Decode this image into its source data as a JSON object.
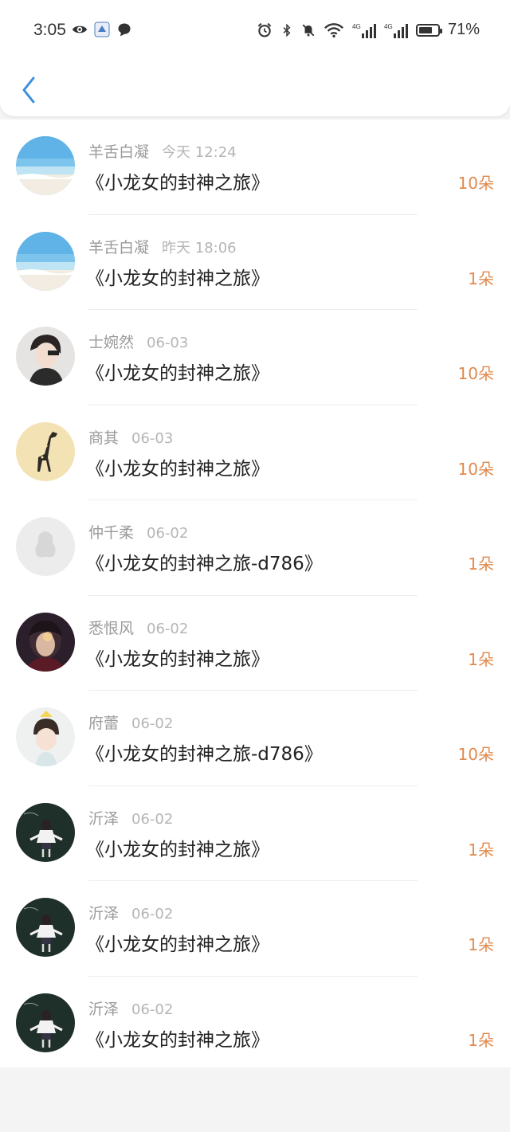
{
  "status_bar": {
    "time": "3:05",
    "battery_pct": "71%",
    "battery_level": 0.71,
    "icons": [
      "eye-icon",
      "app-badge-icon",
      "chat-bubble-icon",
      "alarm-icon",
      "bluetooth-icon",
      "mute-icon",
      "wifi-icon",
      "signal-4g-icon",
      "signal-4g-icon",
      "battery-icon"
    ]
  },
  "header": {
    "back_icon": "chevron-left-icon",
    "accent": "#3b8fe0"
  },
  "colors": {
    "amount": "#e08a4d",
    "name": "#9a9a9a",
    "title": "#222222"
  },
  "items": [
    {
      "name": "羊舌白凝",
      "time": "今天 12:24",
      "title": "《小龙女的封神之旅》",
      "amount": "10朵",
      "avatar": "beach"
    },
    {
      "name": "羊舌白凝",
      "time": "昨天 18:06",
      "title": "《小龙女的封神之旅》",
      "amount": "1朵",
      "avatar": "beach"
    },
    {
      "name": "士婉然",
      "time": "06-03",
      "title": "《小龙女的封神之旅》",
      "amount": "10朵",
      "avatar": "boy"
    },
    {
      "name": "商其",
      "time": "06-03",
      "title": "《小龙女的封神之旅》",
      "amount": "10朵",
      "avatar": "giraffe"
    },
    {
      "name": "仲千柔",
      "time": "06-02",
      "title": "《小龙女的封神之旅-d786》",
      "amount": "1朵",
      "avatar": "default"
    },
    {
      "name": "悉恨风",
      "time": "06-02",
      "title": "《小龙女的封神之旅》",
      "amount": "1朵",
      "avatar": "dark-face"
    },
    {
      "name": "府蕾",
      "time": "06-02",
      "title": "《小龙女的封神之旅-d786》",
      "amount": "10朵",
      "avatar": "child"
    },
    {
      "name": "沂泽",
      "time": "06-02",
      "title": "《小龙女的封神之旅》",
      "amount": "1朵",
      "avatar": "girl-chalkboard"
    },
    {
      "name": "沂泽",
      "time": "06-02",
      "title": "《小龙女的封神之旅》",
      "amount": "1朵",
      "avatar": "girl-chalkboard"
    },
    {
      "name": "沂泽",
      "time": "06-02",
      "title": "《小龙女的封神之旅》",
      "amount": "1朵",
      "avatar": "girl-chalkboard"
    }
  ]
}
